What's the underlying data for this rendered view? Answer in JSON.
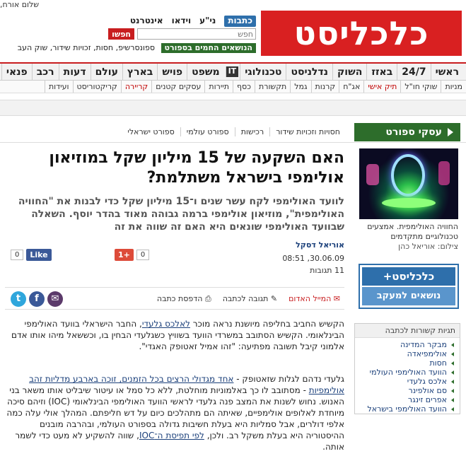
{
  "topbar": {
    "greeting": "שלום אורח,"
  },
  "logo": {
    "text": "כלכליסט"
  },
  "search": {
    "tabs": [
      "כתבות",
      "ני\"ע",
      "וידאו",
      "אינטרנט"
    ],
    "placeholder": "חפש",
    "button": "חפשו",
    "hot_label": "הנושאים החמים בספורט",
    "hot_items": [
      "ספונסרשיפ,",
      "חסות,",
      "זכויות שידור,",
      "שוק העב"
    ]
  },
  "nav_main": [
    "ראשי",
    "24/7",
    "באזז",
    "השוק",
    "נדלניסט",
    "טכנולוגי",
    "IT",
    "משפט",
    "פויש",
    "בארץ",
    "עולם",
    "דעות",
    "רכב",
    "פנאי"
  ],
  "nav_sub": [
    {
      "label": "מניות",
      "dark": true
    },
    {
      "label": "שוקי חו\"ל",
      "dark": true
    },
    {
      "label": "תיק אישי",
      "dark": false
    },
    {
      "label": "אג\"ח",
      "dark": true
    },
    {
      "label": "קרנות",
      "dark": true
    },
    {
      "label": "גמל",
      "dark": true
    },
    {
      "label": "תקשורת",
      "dark": true
    },
    {
      "label": "כסף",
      "dark": true
    },
    {
      "label": "תיירות",
      "dark": true
    },
    {
      "label": "עסקים קטנים",
      "dark": true
    },
    {
      "label": "קריירה",
      "dark": false
    },
    {
      "label": "קריקטוריסט",
      "dark": true
    },
    {
      "label": "ועידות",
      "dark": true
    }
  ],
  "section": {
    "title": "עסקי ספורט",
    "subsections": [
      "חסויות וזכויות שידור",
      "רכישות",
      "ספורט עולמי",
      "ספורט ישראלי"
    ]
  },
  "sidebar": {
    "caption": "החוויה האולימפית. אמצעים טכנולוגיים מתקדמים",
    "credit": "צילום: אוריאל כהן",
    "promo_top": "כלכליסט+",
    "promo_bottom": "נושאים למעקב",
    "tags_title": "תגיות קשורות לכתבה",
    "tags": [
      "מבקר המדינה",
      "אולימפיאדה",
      "חסות",
      "הוועד האולימפי העולמי",
      "אלכס גלעדי",
      "סם אולפינר",
      "אפרים זינגר",
      "הוועד האולימפי בישראל"
    ]
  },
  "article": {
    "headline": "האם השקעה של 15 מיליון שקל במוזיאון אולימפי בישראל משתלמת?",
    "subtitle": "לוועד האולימפי לקח עשר שנים ו־15 מיליון שקל כדי לבנות את \"החוויה האולימפית\", מוזיאון אולימפי ברמה גבוהה מאוד בהדר יוסף. השאלה שבוועד האולימפי שונאים היא האם זה שווה את זה",
    "author": "אוריאל דסקל",
    "date": "30.06.09, 08:51",
    "responses": "11 תגובות",
    "fb_like": "Like",
    "fb_count": "0",
    "gplus": "+1",
    "gplus_count": "0",
    "tool_mail": "המייל האדום",
    "tool_respond": "תגובה לכתבה",
    "tool_print": "הדפסת כתבה",
    "p1_before": "הקשיש החביב בחליפה מיושנת נראה מוכר ",
    "p1_link": "לאלכס גלעדי",
    "p1_after": ", החבר הישראלי בוועד האולימפי הבינלאומי. הקשיש הסתובב במשרדי הוועד בשוויץ כשגלעדי הבחין בו, וכששאל מיהו אותו אדם אלמוני קיבל תשובה מפתיעה: \"זהו אמיל זאטופק האגדי\".",
    "p2_before": "גלעדי נדהם לגלות שזאטופק - ",
    "p2_link": "אחד מגדולי הרצים בכל הזמנים, זוכה בארבע מדליות זהב אולימפיות",
    "p2_mid": " - מסתובב לו כך באלמוניות מוחלטת, ללא כל סמל או עיטור שיבליט אותו משאר בני האנוש. נחוש לשנות את המצב פנה גלעדי לראשי הוועד האולימפי הבינלאומי (IOC) וזיהם סיכה מיוחדת לאלופים אולימפיים, שאיתה הם מתהלכים כיום על דש חליפתם. המהלך אולי עלה כמה אלפי דולרים, אבל סמליות היא בעלת חשיבות גדולה בספורט העולמי, ובהרבה מובנים ההיסטוריה היא בעלת משקל רב. ולכן, ",
    "p2_link2": "לפי תפיסת ה־IOC",
    "p2_after": ", שווה להשקיע לא מעט כדי לשמר אותה."
  },
  "colors": {
    "brand_red": "#d92021",
    "sport_green": "#2d6d2b",
    "link_blue": "#1a3f7a",
    "promo_blue": "#2e6fab"
  }
}
